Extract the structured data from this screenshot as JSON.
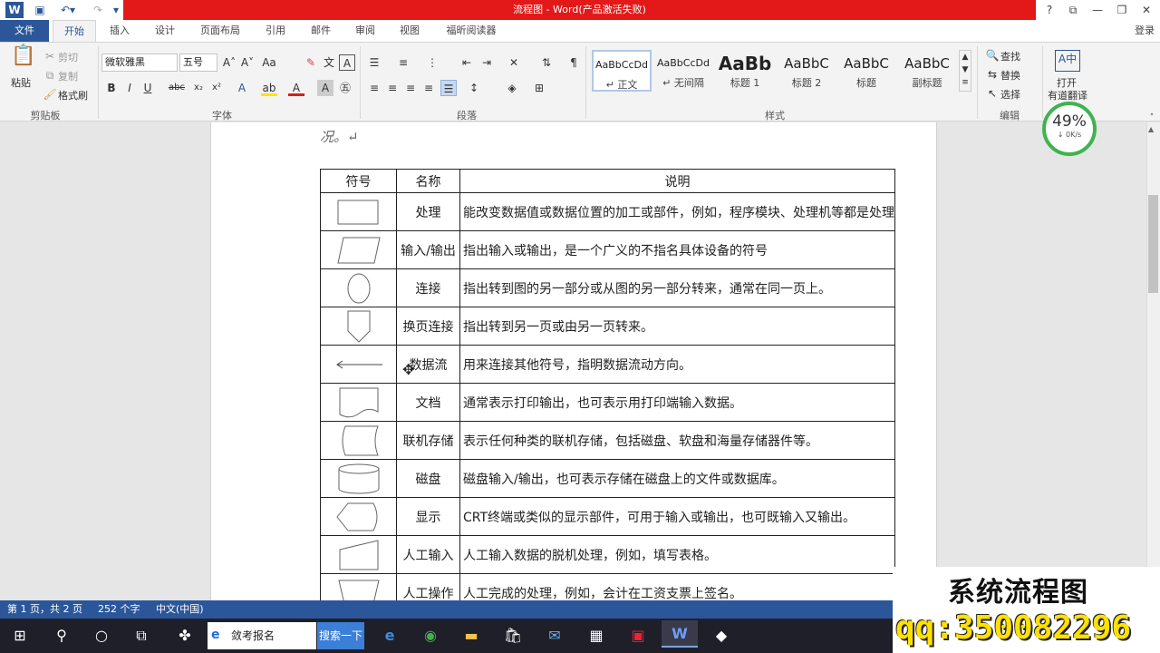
{
  "window": {
    "title": "流程图 - Word(产品激活失败)",
    "signin": "登录",
    "help": "?",
    "controls": [
      "restore",
      "minimize",
      "maximize",
      "close"
    ]
  },
  "tabs": [
    {
      "label": "文件"
    },
    {
      "label": "开始"
    },
    {
      "label": "插入"
    },
    {
      "label": "设计"
    },
    {
      "label": "页面布局"
    },
    {
      "label": "引用"
    },
    {
      "label": "邮件"
    },
    {
      "label": "审阅"
    },
    {
      "label": "视图"
    },
    {
      "label": "福昕阅读器"
    }
  ],
  "ribbon": {
    "clipboard": {
      "paste": "粘贴",
      "cut": "剪切",
      "copy": "复制",
      "format_painter": "格式刷",
      "label": "剪贴板"
    },
    "font": {
      "name": "微软雅黑",
      "size": "五号",
      "label": "字体"
    },
    "paragraph": {
      "label": "段落"
    },
    "styles": {
      "label": "样式",
      "items": [
        {
          "sample": "AaBbCcDd",
          "name": "↵ 正文"
        },
        {
          "sample": "AaBbCcDd",
          "name": "↵ 无间隔"
        },
        {
          "sample": "AaBb",
          "name": "标题 1"
        },
        {
          "sample": "AaBbC",
          "name": "标题 2"
        },
        {
          "sample": "AaBbC",
          "name": "标题"
        },
        {
          "sample": "AaBbC",
          "name": "副标题"
        }
      ]
    },
    "editing": {
      "find": "查找",
      "replace": "替换",
      "select": "选择",
      "label": "编辑"
    },
    "translate": {
      "line1": "打开",
      "line2": "有道翻译"
    }
  },
  "document": {
    "prev_line": "况。↵",
    "table": {
      "headers": [
        "符号",
        "名称",
        "说明"
      ],
      "rows": [
        {
          "shape": "process",
          "name": "处理",
          "desc": "能改变数据值或数据位置的加工或部件，例如，程序模块、处理机等都是处理"
        },
        {
          "shape": "io",
          "name": "输入/输出",
          "desc": "指出输入或输出，是一个广义的不指名具体设备的符号"
        },
        {
          "shape": "connector",
          "name": "连接",
          "desc": "指出转到图的另一部分或从图的另一部分转来，通常在同一页上。"
        },
        {
          "shape": "offpage",
          "name": "换页连接",
          "desc": "指出转到另一页或由另一页转来。"
        },
        {
          "shape": "dataflow",
          "name": "数据流",
          "desc": "用来连接其他符号，指明数据流动方向。"
        },
        {
          "shape": "document",
          "name": "文档",
          "desc": "通常表示打印输出，也可表示用打印端输入数据。"
        },
        {
          "shape": "online",
          "name": "联机存储",
          "desc": "表示任何种类的联机存储，包括磁盘、软盘和海量存储器件等。"
        },
        {
          "shape": "disk",
          "name": "磁盘",
          "desc": "磁盘输入/输出，也可表示存储在磁盘上的文件或数据库。"
        },
        {
          "shape": "display",
          "name": "显示",
          "desc": "CRT终端或类似的显示部件，可用于输入或输出，也可既输入又输出。"
        },
        {
          "shape": "manualinput",
          "name": "人工输入",
          "desc": "人工输入数据的脱机处理，例如，填写表格。"
        },
        {
          "shape": "manualop",
          "name": "人工操作",
          "desc": "人工完成的处理，例如，会计在工资支票上签名。"
        }
      ]
    }
  },
  "status": {
    "page": "第 1 页，共 2 页",
    "words": "252 个字",
    "lang": "中文(中国)"
  },
  "taskbar": {
    "search_text": "敛考报名",
    "search_button": "搜索一下"
  },
  "overlay": {
    "percent": "49%",
    "speed": "↓ 0K/s",
    "watermark_title": "系统流程图",
    "watermark_qq": "qq:350082296"
  }
}
